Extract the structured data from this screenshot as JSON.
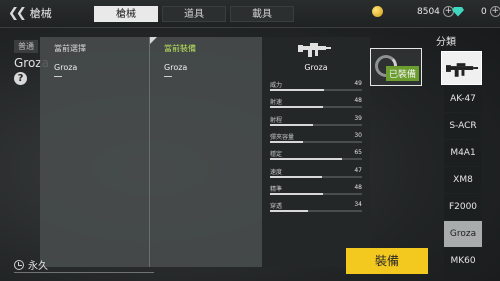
{
  "header": {
    "title": "槍械",
    "tabs": [
      {
        "label": "槍械",
        "active": true
      },
      {
        "label": "道具",
        "active": false
      },
      {
        "label": "載具",
        "active": false
      }
    ],
    "coins": "8504",
    "gems": "0"
  },
  "weapon": {
    "rarity": "普通",
    "name": "Groza",
    "duration": "永久"
  },
  "compare": {
    "current_header": "當前選擇",
    "current_name": "Groza",
    "equipped_header": "當前裝備",
    "equipped_name": "Groza",
    "stats_name": "Groza",
    "stats": [
      {
        "label": "威力",
        "value": "49",
        "fraction": 0.49
      },
      {
        "label": "射速",
        "value": "48",
        "fraction": 0.48
      },
      {
        "label": "射程",
        "value": "39",
        "fraction": 0.39
      },
      {
        "label": "彈夾容量",
        "value": "30",
        "fraction": 0.3
      },
      {
        "label": "穩定",
        "value": "65",
        "fraction": 0.65
      },
      {
        "label": "速度",
        "value": "47",
        "fraction": 0.47
      },
      {
        "label": "精準",
        "value": "48",
        "fraction": 0.48
      },
      {
        "label": "穿透",
        "value": "34",
        "fraction": 0.34
      }
    ]
  },
  "equipped_badge": "已裝備",
  "equip_button": "裝備",
  "category": {
    "title": "分類",
    "items": [
      {
        "label": "AK-47",
        "active": false
      },
      {
        "label": "S-ACR",
        "active": false
      },
      {
        "label": "M4A1",
        "active": false
      },
      {
        "label": "XM8",
        "active": false
      },
      {
        "label": "F2000",
        "active": false
      },
      {
        "label": "Groza",
        "active": true
      },
      {
        "label": "MK60",
        "active": false
      }
    ]
  },
  "colors": {
    "accent_yellow": "#f3c81f",
    "equipped_green": "#6c9d2f",
    "header_green": "#b9e25c"
  }
}
